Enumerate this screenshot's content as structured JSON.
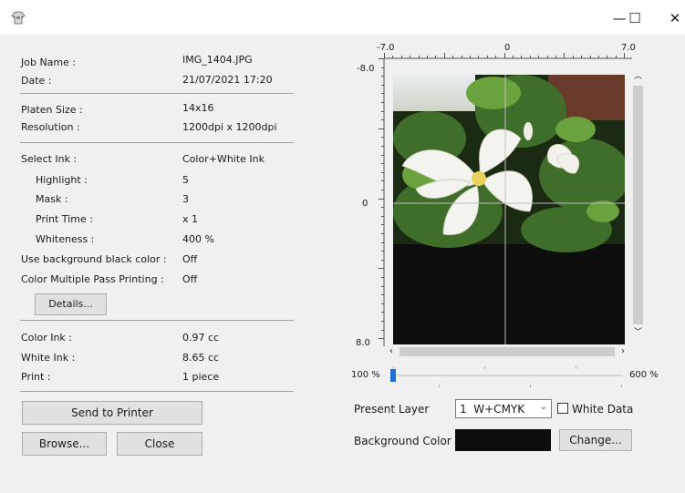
{
  "window": {
    "icon": "printer-shirt-icon",
    "controls": {
      "minimize": "—",
      "maximize": "☐",
      "close": "✕"
    }
  },
  "job": {
    "name_label": "Job Name :",
    "name": "IMG_1404.JPG",
    "date_label": "Date :",
    "date": "21/07/2021 17:20"
  },
  "platen": {
    "size_label": "Platen Size :",
    "size": "14x16",
    "res_label": "Resolution :",
    "res": "1200dpi x 1200dpi"
  },
  "ink": {
    "select_label": "Select Ink :",
    "select": "Color+White Ink",
    "highlight_label": "Highlight :",
    "highlight": "5",
    "mask_label": "Mask :",
    "mask": "3",
    "print_time_label": "Print Time :",
    "print_time": "x 1",
    "whiteness_label": "Whiteness :",
    "whiteness": "400 %",
    "bg_black_label": "Use background black color :",
    "bg_black": "Off",
    "multipass_label": "Color Multiple Pass Printing :",
    "multipass": "Off",
    "details_button": "Details..."
  },
  "usage": {
    "color_label": "Color Ink :",
    "color": "0.97 cc",
    "white_label": "White Ink :",
    "white": "8.65 cc",
    "print_label": "Print :",
    "print": "1 piece"
  },
  "actions": {
    "send": "Send to Printer",
    "browse": "Browse...",
    "close": "Close"
  },
  "ruler": {
    "top_left": "-7.0",
    "top_mid": "0",
    "top_right": "7.0",
    "left_top": "-8.0",
    "left_mid": "0",
    "left_bottom": "8.0"
  },
  "zoom": {
    "min": "100 %",
    "max": "600 %",
    "level": 0.0
  },
  "layer": {
    "label": "Present Layer",
    "value": "1  W+CMYK",
    "white_data_label": "White Data",
    "white_data_checked": false
  },
  "background": {
    "label": "Background Color",
    "color": "#0d0d0d",
    "change_button": "Change..."
  },
  "colors": {
    "canvas": "#0d0d0d",
    "zoom_thumb": "#1f6fd1",
    "window_bg": "#f0f0f0"
  }
}
